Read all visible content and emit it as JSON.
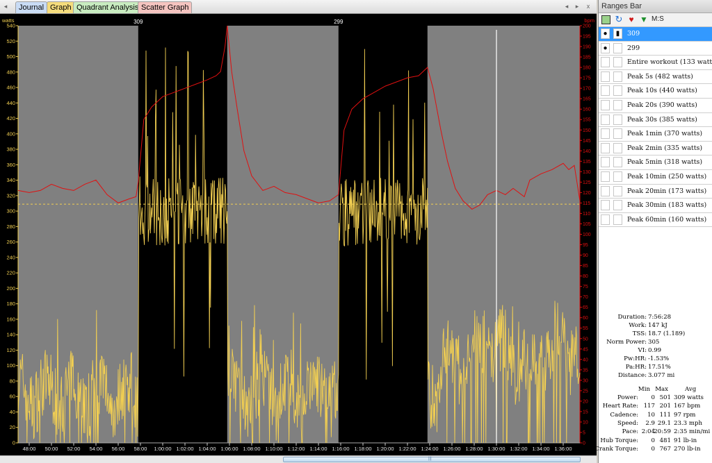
{
  "tabs": [
    {
      "label": "Journal",
      "bg": "#c9dcf5"
    },
    {
      "label": "Graph",
      "bg": "#f5dc7c"
    },
    {
      "label": "Quadrant Analysis",
      "bg": "#c8ecc0"
    },
    {
      "label": "Scatter Graph",
      "bg": "#f5c4c0"
    }
  ],
  "tab_nav": {
    "left": "◂",
    "right_prev": "◂",
    "right_next": "▸",
    "close": "x"
  },
  "chart_data": {
    "type": "line",
    "left_axis_unit": "watts",
    "right_axis_unit": "bpm",
    "power_axis": {
      "min": 0,
      "max": 540,
      "ticks": [
        0,
        20,
        40,
        60,
        80,
        100,
        120,
        140,
        160,
        180,
        200,
        220,
        240,
        260,
        280,
        300,
        320,
        340,
        360,
        380,
        400,
        420,
        440,
        460,
        480,
        500,
        520,
        540
      ]
    },
    "hr_axis": {
      "min": 0,
      "max": 200,
      "ticks": [
        0,
        5,
        10,
        15,
        20,
        25,
        30,
        35,
        40,
        45,
        50,
        55,
        60,
        65,
        70,
        75,
        80,
        85,
        90,
        95,
        100,
        105,
        110,
        115,
        120,
        125,
        130,
        135,
        140,
        145,
        150,
        155,
        160,
        165,
        170,
        175,
        180,
        185,
        190,
        195,
        200
      ]
    },
    "time_axis": {
      "start_min": 47.0,
      "end_min": 97.5,
      "tick_labels": [
        "48:00",
        "50:00",
        "52:00",
        "54:00",
        "56:00",
        "58:00",
        "1:00:00",
        "1:02:00",
        "1:04:00",
        "1:06:00",
        "1:08:00",
        "1:10:00",
        "1:12:00",
        "1:14:00",
        "1:16:00",
        "1:18:00",
        "1:20:00",
        "1:22:00",
        "1:24:00",
        "1:26:00",
        "1:28:00",
        "1:30:00",
        "1:32:00",
        "1:34:00",
        "1:36:00"
      ],
      "tick_minutes": [
        48,
        50,
        52,
        54,
        56,
        58,
        60,
        62,
        64,
        66,
        68,
        70,
        72,
        74,
        76,
        78,
        80,
        82,
        84,
        86,
        88,
        90,
        92,
        94,
        96
      ]
    },
    "ranges": [
      {
        "label": "309",
        "start_min": 57.8,
        "end_min": 65.8
      },
      {
        "label": "299",
        "start_min": 75.8,
        "end_min": 83.8
      }
    ],
    "avg_power_line": 309,
    "cursor_min": 90.0,
    "heart_rate": {
      "name": "Heart Rate",
      "color": "#e01010",
      "points": [
        [
          47.0,
          121
        ],
        [
          48.0,
          120
        ],
        [
          49.0,
          121
        ],
        [
          50.0,
          124
        ],
        [
          51.0,
          122
        ],
        [
          52.0,
          121
        ],
        [
          53.0,
          124
        ],
        [
          54.0,
          126
        ],
        [
          55.0,
          119
        ],
        [
          56.0,
          115
        ],
        [
          57.0,
          117
        ],
        [
          57.6,
          118
        ],
        [
          57.8,
          125
        ],
        [
          58.3,
          155
        ],
        [
          59.0,
          161
        ],
        [
          60.0,
          166
        ],
        [
          61.0,
          168
        ],
        [
          62.0,
          170
        ],
        [
          63.0,
          172
        ],
        [
          64.0,
          174
        ],
        [
          64.8,
          176
        ],
        [
          65.2,
          178
        ],
        [
          65.6,
          190
        ],
        [
          65.8,
          200
        ],
        [
          66.2,
          178
        ],
        [
          66.7,
          160
        ],
        [
          67.3,
          140
        ],
        [
          68.0,
          128
        ],
        [
          69.0,
          121
        ],
        [
          70.0,
          123
        ],
        [
          71.0,
          120
        ],
        [
          72.0,
          119
        ],
        [
          73.0,
          117
        ],
        [
          74.0,
          115
        ],
        [
          75.0,
          116
        ],
        [
          75.8,
          119
        ],
        [
          76.3,
          150
        ],
        [
          77.0,
          160
        ],
        [
          78.0,
          165
        ],
        [
          79.0,
          168
        ],
        [
          80.0,
          171
        ],
        [
          81.0,
          173
        ],
        [
          82.0,
          175
        ],
        [
          83.0,
          176
        ],
        [
          83.8,
          180
        ],
        [
          84.3,
          170
        ],
        [
          85.0,
          150
        ],
        [
          85.6,
          135
        ],
        [
          86.3,
          122
        ],
        [
          87.0,
          116
        ],
        [
          87.8,
          112
        ],
        [
          88.5,
          114
        ],
        [
          89.2,
          119
        ],
        [
          90.0,
          121
        ],
        [
          90.8,
          119
        ],
        [
          91.5,
          122
        ],
        [
          92.5,
          118
        ],
        [
          93.0,
          126
        ],
        [
          94.0,
          129
        ],
        [
          95.0,
          131
        ],
        [
          96.0,
          134
        ],
        [
          96.5,
          131
        ],
        [
          97.0,
          133
        ],
        [
          97.5,
          116
        ]
      ]
    },
    "power": {
      "name": "Power",
      "color": "#f2cf52"
    }
  },
  "sidebar": {
    "title": "Ranges Bar",
    "toolbar_text": "M:S",
    "rows": [
      {
        "label": "309",
        "eye": "👁",
        "lock": "🔒",
        "selected": true
      },
      {
        "label": "299",
        "eye": "👁",
        "lock": "",
        "selected": false
      },
      {
        "label": "Entire workout (133 watts)",
        "eye": "",
        "lock": "",
        "selected": false
      },
      {
        "label": "Peak 5s (482 watts)",
        "eye": "",
        "lock": "",
        "selected": false
      },
      {
        "label": "Peak 10s (440 watts)",
        "eye": "",
        "lock": "",
        "selected": false
      },
      {
        "label": "Peak 20s (390 watts)",
        "eye": "",
        "lock": "",
        "selected": false
      },
      {
        "label": "Peak 30s (385 watts)",
        "eye": "",
        "lock": "",
        "selected": false
      },
      {
        "label": "Peak 1min (370 watts)",
        "eye": "",
        "lock": "",
        "selected": false
      },
      {
        "label": "Peak 2min (335 watts)",
        "eye": "",
        "lock": "",
        "selected": false
      },
      {
        "label": "Peak 5min (318 watts)",
        "eye": "",
        "lock": "",
        "selected": false
      },
      {
        "label": "Peak 10min (250 watts)",
        "eye": "",
        "lock": "",
        "selected": false
      },
      {
        "label": "Peak 20min (173 watts)",
        "eye": "",
        "lock": "",
        "selected": false
      },
      {
        "label": "Peak 30min (183 watts)",
        "eye": "",
        "lock": "",
        "selected": false
      },
      {
        "label": "Peak 60min (160 watts)",
        "eye": "",
        "lock": "",
        "selected": false
      }
    ],
    "summary": [
      {
        "k": "Duration:",
        "v": "7:56:28"
      },
      {
        "k": "Work:",
        "v": "147 kJ"
      },
      {
        "k": "TSS:",
        "v": "18.7 (1.189)"
      },
      {
        "k": "Norm Power:",
        "v": "305"
      },
      {
        "k": "VI:",
        "v": "0.99"
      },
      {
        "k": "Pw:HR:",
        "v": "-1.53%"
      },
      {
        "k": "Pa:HR:",
        "v": "17.51%"
      },
      {
        "k": "Distance:",
        "v": "3.077 mi"
      }
    ],
    "table_headers": [
      "Min",
      "Max",
      "Avg"
    ],
    "table": [
      {
        "k": "Power:",
        "min": "0",
        "max": "501",
        "avg": "309 watts"
      },
      {
        "k": "Heart Rate:",
        "min": "117",
        "max": "201",
        "avg": "167 bpm"
      },
      {
        "k": "Cadence:",
        "min": "10",
        "max": "111",
        "avg": "97 rpm"
      },
      {
        "k": "Speed:",
        "min": "2.9",
        "max": "29.1",
        "avg": "23.3 mph"
      },
      {
        "k": "Pace:",
        "min": "2:04",
        "max": "20:59",
        "avg": "2:35 min/mi"
      },
      {
        "k": "Hub Torque:",
        "min": "0",
        "max": "481",
        "avg": "91 lb-in"
      },
      {
        "k": "Crank Torque:",
        "min": "0",
        "max": "767",
        "avg": "270 lb-in"
      }
    ]
  }
}
